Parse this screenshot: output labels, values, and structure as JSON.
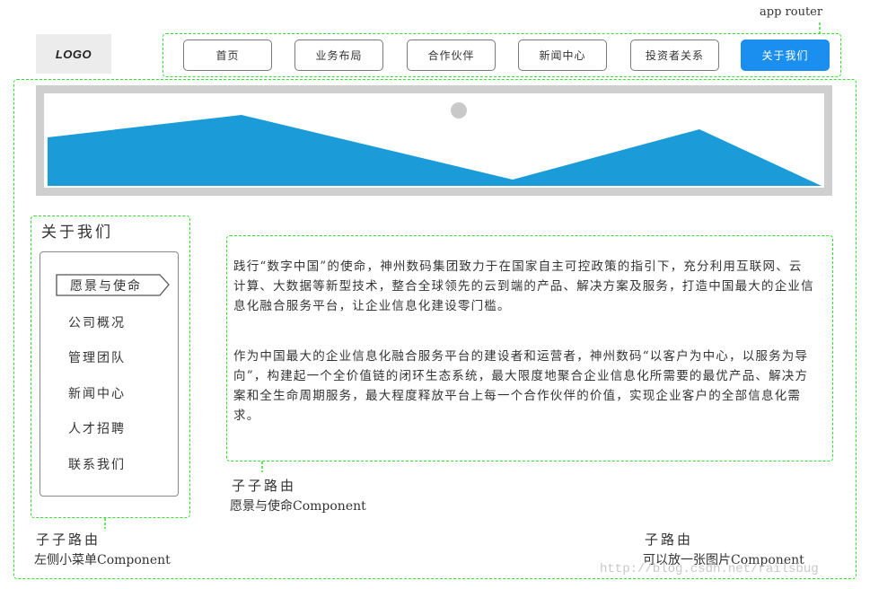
{
  "annotations": {
    "app_router": "app router",
    "sub_sub_route_1": "子子路由",
    "vision_component": "愿景与使命Component",
    "sub_sub_route_2": "子子路由",
    "sidebar_component": "左侧小菜单Component",
    "sub_route": "子路由",
    "image_component": "可以放一张图片Component"
  },
  "header": {
    "logo": "LOGO",
    "nav": [
      {
        "label": "首页",
        "active": false
      },
      {
        "label": "业务布局",
        "active": false
      },
      {
        "label": "合作伙伴",
        "active": false
      },
      {
        "label": "新闻中心",
        "active": false
      },
      {
        "label": "投资者关系",
        "active": false
      },
      {
        "label": "关于我们",
        "active": true
      }
    ]
  },
  "sidebar": {
    "title": "关于我们",
    "items": [
      "愿景与使命",
      "公司概况",
      "管理团队",
      "新闻中心",
      "人才招聘",
      "联系我们"
    ]
  },
  "content": {
    "paragraphs": [
      "践行“数字中国”的使命，神州数码集团致力于在国家自主可控政策的指引下，充分利用互联网、云计算、大数据等新型技术，整合全球领先的云到端的产品、解决方案及服务，打造中国最大的企业信息化融合服务平台，让企业信息化建设零门槛。",
      "作为中国最大的企业信息化融合服务平台的建设者和运营者，神州数码“以客户为中心，以服务为导向”，构建起一个全价值链的闭环生态系统，最大限度地聚合企业信息化所需要的最优产品、解决方案和全生命周期服务，最大程度释放平台上每一个合作伙伴的价值，实现企业客户的全部信息化需求。"
    ]
  },
  "watermark": "http://blog.csdn.net/railsbug",
  "colors": {
    "accent": "#1a8ff0",
    "mountain": "#1b9bd7",
    "dashed_outline": "#2ee22e",
    "frame_gray": "#cfcfcf"
  }
}
